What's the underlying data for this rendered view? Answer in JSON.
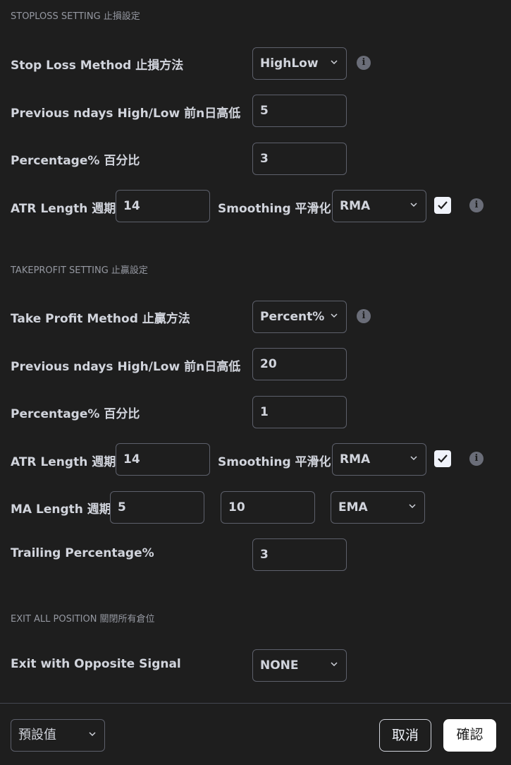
{
  "stoploss": {
    "section_title": "STOPLOSS SETTING 止損設定",
    "method_label": "Stop Loss Method 止損方法",
    "method_value": "HighLow",
    "ndays_label": "Previous ndays High/Low 前n日高低",
    "ndays_value": "5",
    "percentage_label": "Percentage% 百分比",
    "percentage_value": "3",
    "atr_label": "ATR Length 週期",
    "atr_value": "14",
    "smoothing_label": "Smoothing 平滑化",
    "smoothing_value": "RMA",
    "smoothing_checked": true
  },
  "takeprofit": {
    "section_title": "TAKEPROFIT SETTING 止贏設定",
    "method_label": "Take Profit Method 止贏方法",
    "method_value": "Percent%",
    "ndays_label": "Previous ndays High/Low 前n日高低",
    "ndays_value": "20",
    "percentage_label": "Percentage% 百分比",
    "percentage_value": "1",
    "atr_label": "ATR Length 週期",
    "atr_value": "14",
    "smoothing_label": "Smoothing 平滑化",
    "smoothing_value": "RMA",
    "smoothing_checked": true,
    "ma_label": "MA Length 週期",
    "ma_value_1": "5",
    "ma_value_2": "10",
    "ma_type": "EMA",
    "trailing_label": "Trailing Percentage%",
    "trailing_value": "3"
  },
  "exit": {
    "section_title": "EXIT ALL POSITION 關閉所有倉位",
    "opposite_label": "Exit with Opposite Signal",
    "opposite_value": "NONE"
  },
  "footer": {
    "defaults_value": "預設值",
    "cancel_label": "取消",
    "confirm_label": "確認"
  },
  "colors": {
    "background": "#1e1e1e",
    "border": "#5d606b",
    "text": "#d1d4dc",
    "muted": "#9598a1",
    "confirm_bg": "#ffffff"
  },
  "icons": [
    "chevron-down-icon",
    "info-icon",
    "check-icon"
  ]
}
